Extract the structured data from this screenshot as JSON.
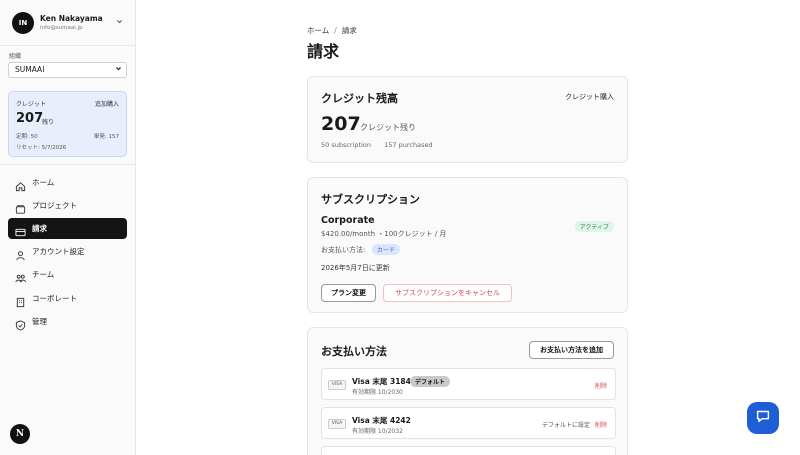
{
  "user": {
    "initials": "IN",
    "name": "Ken Nakayama",
    "email": "info@sumaai.jp"
  },
  "org": {
    "label": "組織",
    "selected": "SUMAAI"
  },
  "credits_panel": {
    "label": "クレジット",
    "add": "追加購入",
    "remaining": "207",
    "remaining_unit": "残り",
    "subscription": "定期: 50",
    "purchased": "単発: 157",
    "reset": "リセット: 5/7/2026"
  },
  "nav": [
    {
      "label": "ホーム",
      "icon": "home-icon"
    },
    {
      "label": "プロジェクト",
      "icon": "folder-icon"
    },
    {
      "label": "請求",
      "icon": "credit-card-icon",
      "active": true
    },
    {
      "label": "アカウント設定",
      "icon": "user-icon"
    },
    {
      "label": "チーム",
      "icon": "team-icon"
    },
    {
      "label": "コーポレート",
      "icon": "building-icon"
    },
    {
      "label": "管理",
      "icon": "shield-icon"
    }
  ],
  "bottom_logo": "N",
  "breadcrumb": {
    "home": "ホーム",
    "sep": "/",
    "current": "請求"
  },
  "page_title": "請求",
  "credit_balance": {
    "title": "クレジット残高",
    "buy": "クレジット購入",
    "amount": "207",
    "unit": "クレジット残り",
    "subscription": "50 subscription",
    "purchased": "157 purchased"
  },
  "subscription": {
    "title": "サブスクリプション",
    "plan": "Corporate",
    "price": "$420.00/month ・100クレジット / 月",
    "status": "アクティブ",
    "payment_label": "お支払い方法:",
    "payment_tag": "カード",
    "renew": "2026年5月7日に更新",
    "change_plan": "プラン変更",
    "cancel": "サブスクリプションをキャンセル"
  },
  "payment_methods": {
    "title": "お支払い方法",
    "add": "お支払い方法を追加",
    "cards": [
      {
        "brand": "VISA",
        "name": "Visa 末尾 3184",
        "expiry": "有効期限 10/2030",
        "default_badge": "デフォルト",
        "delete": "削除"
      },
      {
        "brand": "VISA",
        "name": "Visa 末尾 4242",
        "expiry": "有効期限 10/2032",
        "set_default": "デフォルトに設定",
        "delete": "削除"
      }
    ]
  },
  "colors": {
    "accent": "#1f5fd6",
    "danger": "#d94a4a",
    "active_nav": "#141414"
  }
}
